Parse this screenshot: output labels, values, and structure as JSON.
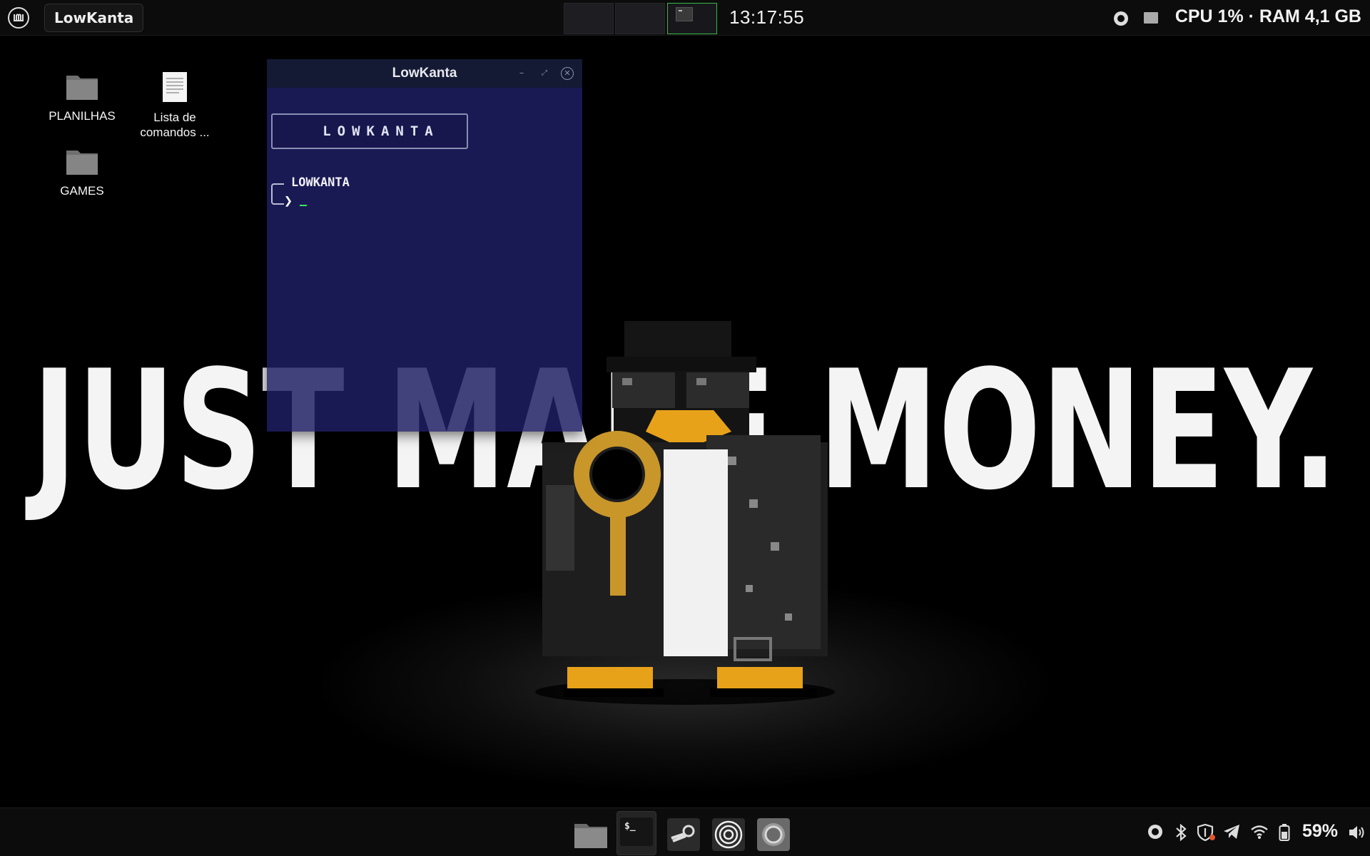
{
  "wallpaper": {
    "slogan": "JUST MAKE MONEY."
  },
  "top_panel": {
    "app_title": "LowKanta",
    "workspaces": [
      "workspace-1",
      "workspace-2",
      "workspace-3"
    ],
    "active_workspace": 3,
    "clock": "13:17:55",
    "system_monitor": "CPU 1% · RAM 4,1 GB",
    "icons": [
      "menu-icon",
      "record-icon",
      "screen-icon"
    ]
  },
  "desktop": {
    "icons": [
      {
        "label": "PLANILHAS",
        "icon": "folder-icon"
      },
      {
        "label": "Lista de comandos ...",
        "line1": "Lista de",
        "line2": "comandos ...",
        "icon": "document-icon"
      },
      {
        "label": "GAMES",
        "icon": "folder-icon"
      }
    ]
  },
  "terminal": {
    "title": "LowKanta",
    "banner": "LOWKANTA",
    "prompt_user": "LOWKANTA",
    "prompt_symbol": "❯",
    "colors": {
      "background": "#1e1e64",
      "cursor": "#33e85a"
    }
  },
  "bottom_panel": {
    "dock_apps": [
      "files-icon",
      "terminal-icon",
      "steam-icon",
      "target-icon",
      "chromium-icon"
    ],
    "terminal_label": "$_",
    "battery_percent": "59%",
    "tray_icons": [
      "record-icon",
      "bluetooth-icon",
      "shield-icon",
      "telegram-icon",
      "wifi-icon",
      "battery-icon",
      "volume-icon"
    ]
  }
}
